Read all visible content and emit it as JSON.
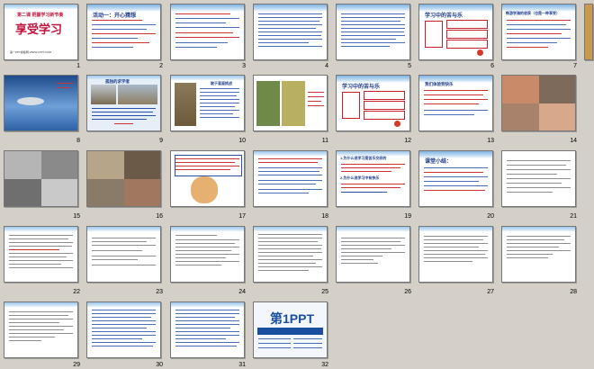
{
  "slide_numbers": [
    "1",
    "2",
    "3",
    "4",
    "5",
    "6",
    "7",
    "8",
    "9",
    "10",
    "11",
    "12",
    "13",
    "14",
    "15",
    "16",
    "17",
    "18",
    "19",
    "20",
    "21",
    "22",
    "23",
    "24",
    "25",
    "26",
    "27",
    "28",
    "29",
    "30",
    "31",
    "32"
  ],
  "slide1": {
    "lesson": "第二课  把握学习新节奏",
    "title": "享受学习",
    "footer": "第一PPT模板网-WWW.1PPT.COM"
  },
  "slide2": {
    "heading": "活动一：开心猜想"
  },
  "slide6": {
    "heading": "学习中的苦与乐"
  },
  "slide7": {
    "heading": "畅游学海的收获（也是一种享受）"
  },
  "slide9": {
    "heading": "孤独的求学者"
  },
  "slide10": {
    "heading": "敢于直面挑战"
  },
  "slide13": {
    "heading": "学习中的苦与乐"
  },
  "slide14": {
    "heading": "我们体验到快乐"
  },
  "slide18": {
    "heading": "1.为什么说学习是苦乐交织的"
  },
  "slide19": {
    "heading": "2.为什么说学习中有快乐"
  },
  "slide20": {
    "heading": "课堂小结："
  },
  "slide32": {
    "logo": "第1PPT"
  }
}
